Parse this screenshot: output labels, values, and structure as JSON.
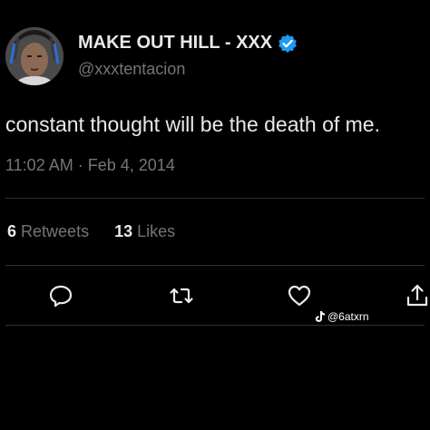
{
  "author": {
    "display_name": "MAKE OUT HILL - XXX",
    "handle": "@xxxtentacion",
    "verified": true,
    "avatar_icon": "user-avatar"
  },
  "tweet": {
    "text": "constant thought will be the death of me.",
    "time": "11:02 AM",
    "separator": "·",
    "date": "Feb 4, 2014"
  },
  "stats": {
    "retweets_count": "6",
    "retweets_label": "Retweets",
    "likes_count": "13",
    "likes_label": "Likes"
  },
  "actions": {
    "reply_icon": "reply-icon",
    "retweet_icon": "retweet-icon",
    "like_icon": "heart-icon",
    "share_icon": "share-icon"
  },
  "watermark": {
    "text": "@6atxrn",
    "icon": "tiktok-icon"
  },
  "colors": {
    "background": "#000000",
    "text_primary": "#e7e9ea",
    "text_secondary": "#71767b",
    "divider": "#2f3336",
    "verified_badge": "#1d9bf0"
  }
}
